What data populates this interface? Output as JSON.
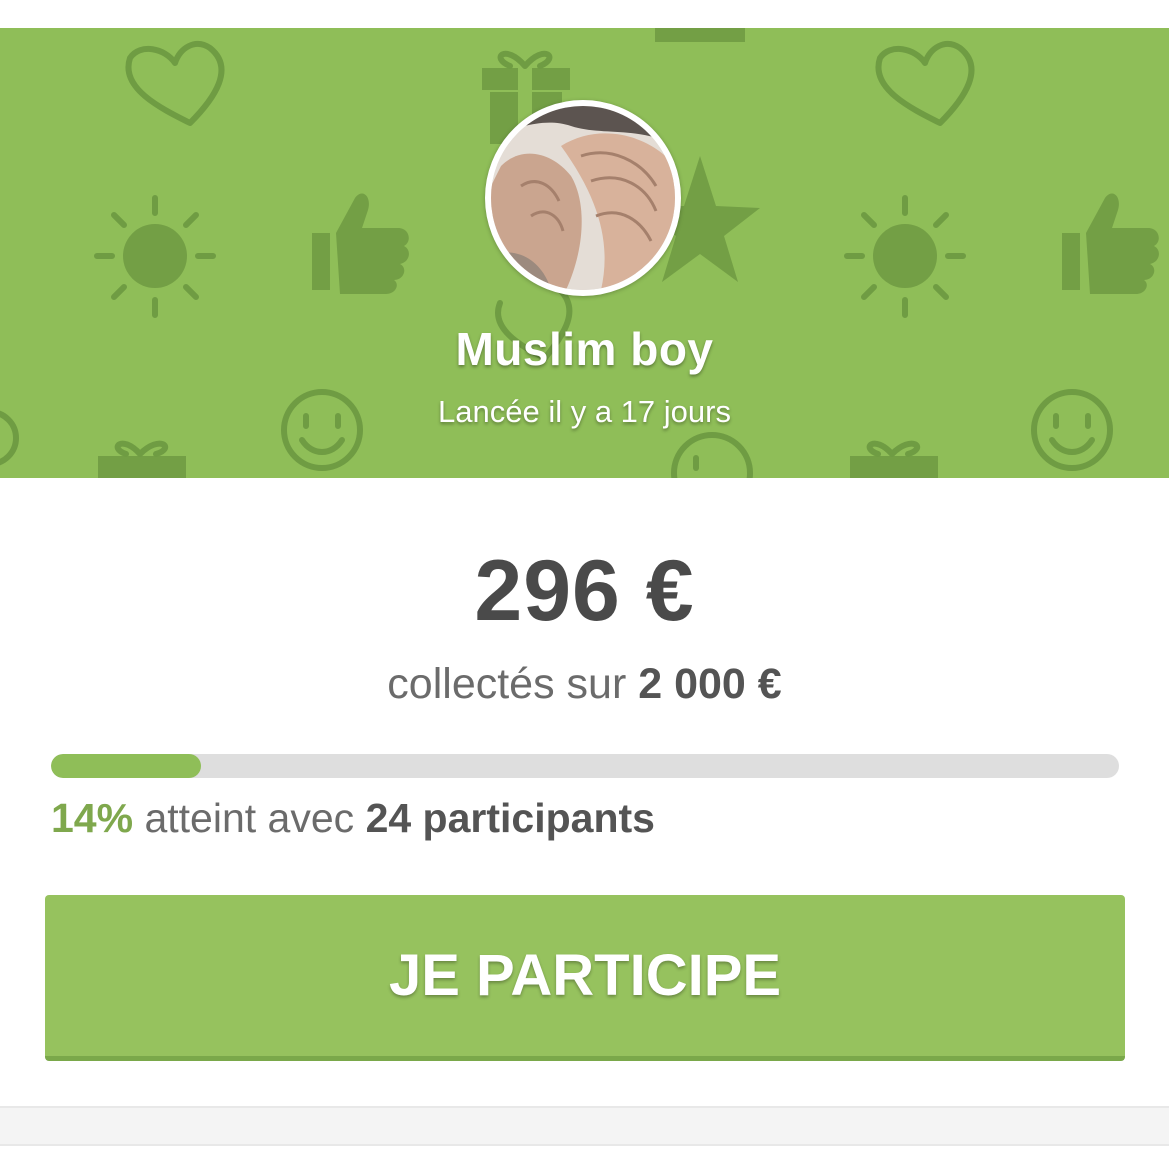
{
  "campaign": {
    "title": "Muslim boy",
    "launched": "Lancée il y a 17 jours",
    "avatar_icon": "praying-hands-photo"
  },
  "funding": {
    "collected": "296 €",
    "goal_prefix": "collectés sur",
    "goal_amount": "2 000 €",
    "progress_percent": 14,
    "percent_label": "14%",
    "reached_text": "atteint avec",
    "participants_label": "24 participants"
  },
  "cta": {
    "label": "JE PARTICIPE"
  },
  "colors": {
    "banner": "#8fbe58",
    "pattern": "#6f9c43",
    "button": "#96c25e",
    "text_dark": "#4a4a4a",
    "text_muted": "#6b6b6b",
    "progress_track": "#dedede"
  },
  "banner_pattern_icons": [
    "heart-icon",
    "gift-icon",
    "thumbs-up-icon",
    "sun-icon",
    "star-icon",
    "smiley-icon"
  ]
}
